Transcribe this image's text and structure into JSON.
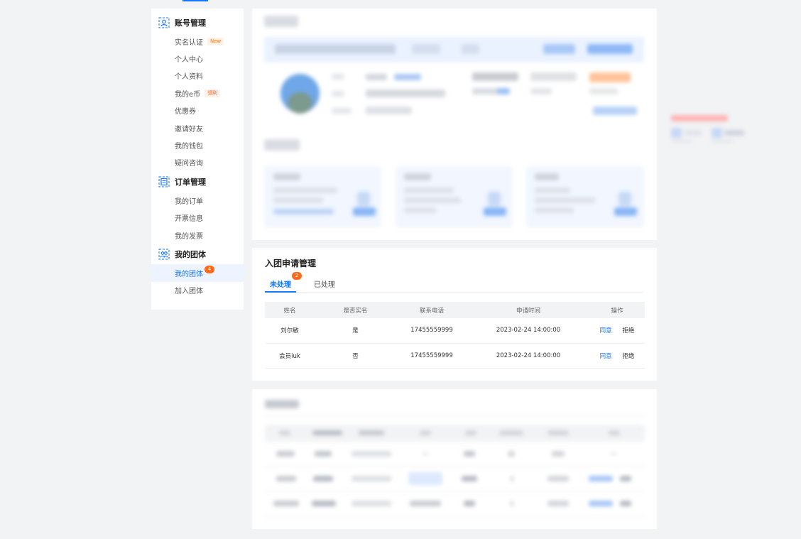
{
  "sidebar": {
    "groups": [
      {
        "title": "账号管理",
        "icon": "account-icon",
        "items": [
          {
            "label": "实名认证",
            "tag": "New"
          },
          {
            "label": "个人中心"
          },
          {
            "label": "个人资料"
          },
          {
            "label": "我的e币",
            "tag": "领利"
          },
          {
            "label": "优惠券"
          },
          {
            "label": "邀请好友"
          },
          {
            "label": "我的钱包"
          },
          {
            "label": "疑问咨询"
          }
        ]
      },
      {
        "title": "订单管理",
        "icon": "order-icon",
        "items": [
          {
            "label": "我的订单"
          },
          {
            "label": "开票信息"
          },
          {
            "label": "我的发票"
          }
        ]
      },
      {
        "title": "我的团体",
        "icon": "team-icon",
        "items": [
          {
            "label": "我的团体",
            "badge": "4",
            "active": true
          },
          {
            "label": "加入团体"
          }
        ]
      }
    ]
  },
  "applications": {
    "title": "入团申请管理",
    "tabs": [
      {
        "label": "未处理",
        "count": "2",
        "active": true
      },
      {
        "label": "已处理"
      }
    ],
    "columns": [
      "姓名",
      "是否实名",
      "联系电话",
      "申请时间",
      "操作"
    ],
    "rows": [
      {
        "name": "刘尔敏",
        "verified": "是",
        "phone": "17455559999",
        "time": "2023-02-24 14:00:00"
      },
      {
        "name": "会员iuk",
        "verified": "否",
        "phone": "17455559999",
        "time": "2023-02-24 14:00:00"
      }
    ],
    "actions": {
      "agree": "同意",
      "reject": "拒绝"
    }
  },
  "colors": {
    "accent": "#1677ff",
    "badge": "#ff6a1a",
    "background": "#f2f3f5"
  }
}
